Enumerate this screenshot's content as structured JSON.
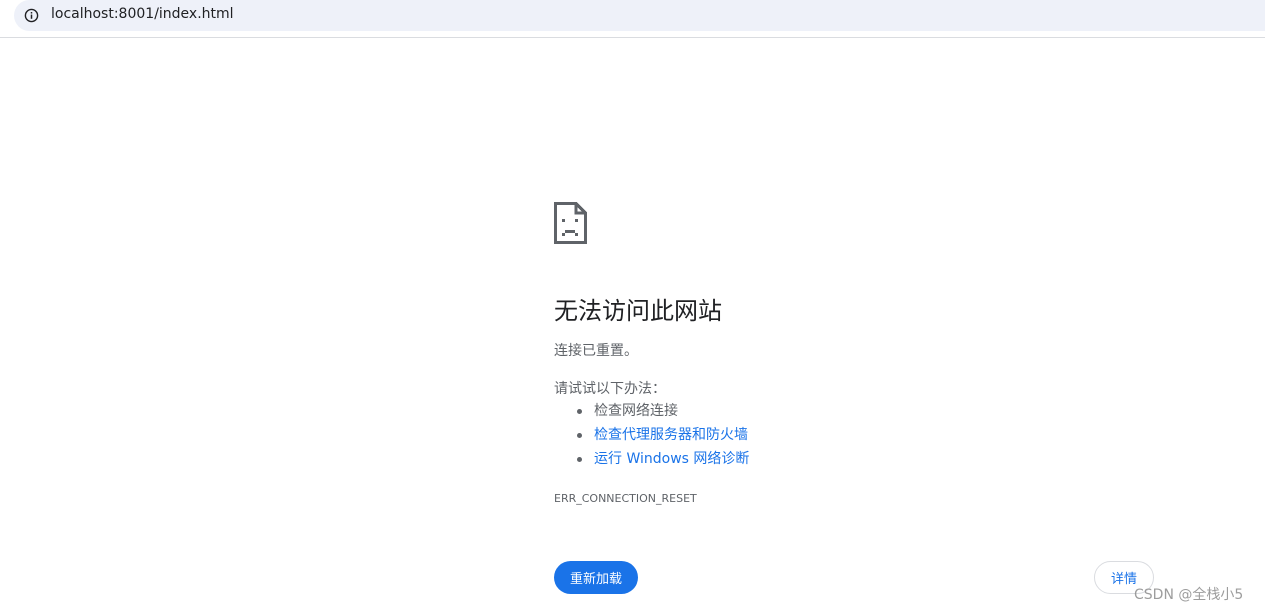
{
  "address_bar": {
    "url": "localhost:8001/index.html",
    "info_icon": "info-circle-icon"
  },
  "error_page": {
    "icon": "sad-page-icon",
    "heading": "无法访问此网站",
    "subtitle": "连接已重置。",
    "try_label": "请试试以下办法：",
    "suggestions": [
      {
        "text": "检查网络连接",
        "is_link": false
      },
      {
        "text": "检查代理服务器和防火墙",
        "is_link": true
      },
      {
        "text": "运行 Windows 网络诊断",
        "is_link": true
      }
    ],
    "error_code": "ERR_CONNECTION_RESET",
    "reload_label": "重新加载",
    "details_label": "详情"
  },
  "watermark": "CSDN @全栈小5",
  "colors": {
    "accent": "#1a73e8",
    "text_primary": "#202124",
    "text_secondary": "#5f6368",
    "omnibox_bg": "#eef1f9"
  }
}
